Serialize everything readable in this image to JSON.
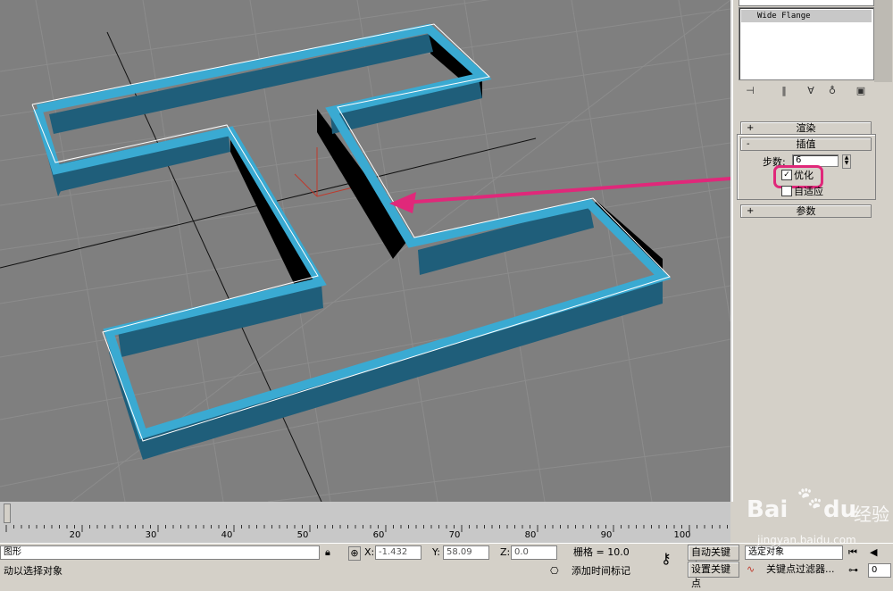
{
  "modifier_list": {
    "items": [
      "Wide Flange"
    ]
  },
  "toolbar_icons": [
    "pin-icon",
    "show-end-result-icon",
    "make-unique-icon",
    "remove-modifier-icon",
    "configure-sets-icon"
  ],
  "rollouts": {
    "render": {
      "sign": "+",
      "label": "渲染"
    },
    "interpolation": {
      "sign": "-",
      "label": "插值",
      "steps_label": "步数:",
      "steps_value": "6",
      "optimize_label": "优化",
      "optimize_checked": true,
      "adaptive_label": "自适应",
      "adaptive_checked": false
    },
    "parameters": {
      "sign": "+",
      "label": "参数"
    }
  },
  "timeline": {
    "ticks": [
      "20",
      "30",
      "40",
      "50",
      "60",
      "70",
      "80",
      "90",
      "100"
    ]
  },
  "status": {
    "selection_text": "图形",
    "prompt_text": "动以选择对象",
    "x_label": "X:",
    "x_value": "-1.432",
    "y_label": "Y:",
    "y_value": "58.09",
    "z_label": "Z:",
    "z_value": "0.0",
    "grid_text": "栅格 = 10.0",
    "auto_key": "自动关键点",
    "set_key": "设置关键点",
    "selected_dropdown": "选定对象",
    "key_filters": "关键点过滤器...",
    "add_time_tag": "添加时间标记",
    "frame_value": "0"
  },
  "watermark": {
    "brand": "Bai",
    "brand2": "du",
    "cn": "经验",
    "url": "jingyan.baidu.com"
  },
  "colors": {
    "viewport_bg": "#7f7f7f",
    "wall_top": "#3aaad2",
    "wall_side": "#1f5e7a",
    "arrow": "#e0287a"
  }
}
